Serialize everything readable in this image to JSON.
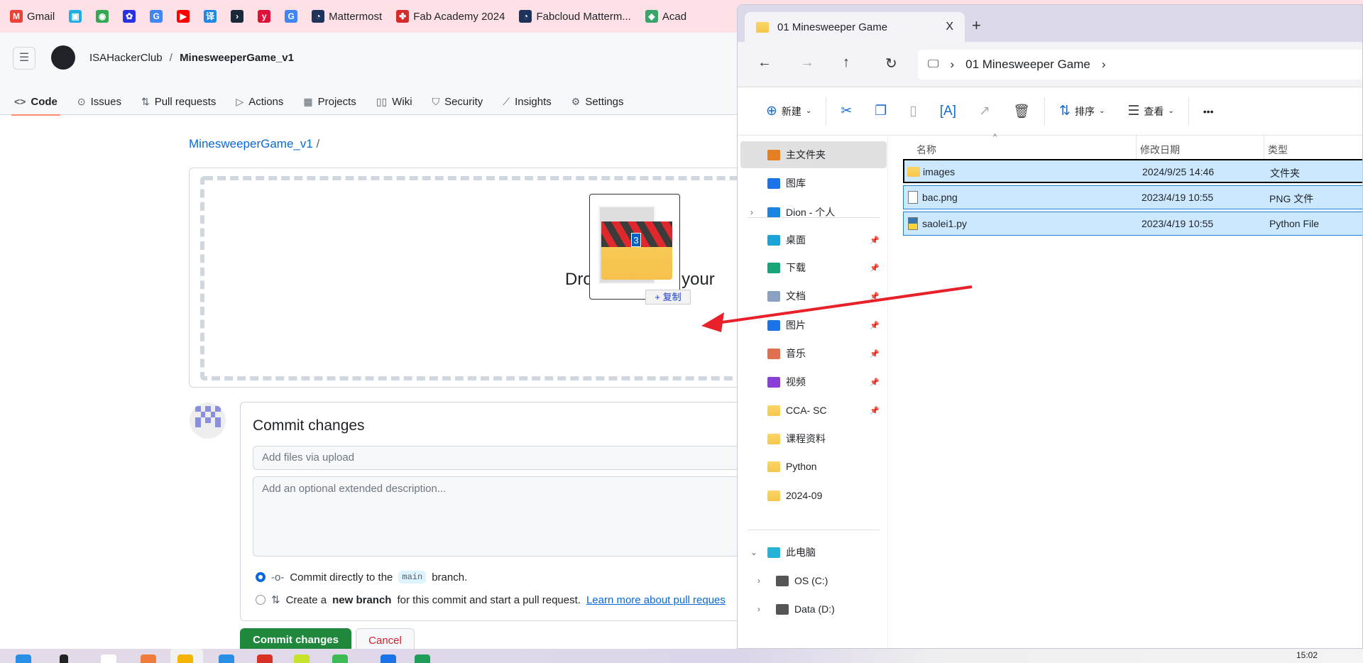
{
  "bookmarks": [
    {
      "label": "Gmail",
      "icon": "gmail-icon",
      "color": "#ea4335",
      "glyph": "M"
    },
    {
      "label": "",
      "icon": "bilibili-icon",
      "color": "#23ade5",
      "glyph": "▣"
    },
    {
      "label": "",
      "icon": "google-maps-icon",
      "color": "#34a853",
      "glyph": "◉"
    },
    {
      "label": "",
      "icon": "baidu-icon",
      "color": "#2932e1",
      "glyph": "✿"
    },
    {
      "label": "",
      "icon": "google-icon",
      "color": "#4285f4",
      "glyph": "G"
    },
    {
      "label": "",
      "icon": "youtube-icon",
      "color": "#ff0000",
      "glyph": "▶"
    },
    {
      "label": "",
      "icon": "translate-icon",
      "color": "#1e88e5",
      "glyph": "译"
    },
    {
      "label": "",
      "icon": "hex-app-icon",
      "color": "#1b2a3a",
      "glyph": "›"
    },
    {
      "label": "",
      "icon": "yuque-icon",
      "color": "#e0103a",
      "glyph": "y"
    },
    {
      "label": "",
      "icon": "google-translate-icon",
      "color": "#4285f4",
      "glyph": "G"
    },
    {
      "label": "Mattermost",
      "icon": "mattermost-icon",
      "color": "#1e325c",
      "glyph": "◔"
    },
    {
      "label": "Fab Academy 2024",
      "icon": "fablab-icon",
      "color": "#d62b2b",
      "glyph": "✤"
    },
    {
      "label": "Fabcloud Matterm...",
      "icon": "mattermost-icon",
      "color": "#1e325c",
      "glyph": "◔"
    },
    {
      "label": "Acad",
      "icon": "academy-icon",
      "color": "#3aa56b",
      "glyph": "◈"
    }
  ],
  "github": {
    "owner": "ISAHackerClub",
    "separator": "/",
    "repo": "MinesweeperGame_v1",
    "tabs": [
      {
        "label": "Code",
        "icon": "code-icon",
        "glyph": "<>",
        "active": true
      },
      {
        "label": "Issues",
        "icon": "issues-icon",
        "glyph": "⊙"
      },
      {
        "label": "Pull requests",
        "icon": "pull-request-icon",
        "glyph": "⇅"
      },
      {
        "label": "Actions",
        "icon": "actions-icon",
        "glyph": "▷"
      },
      {
        "label": "Projects",
        "icon": "projects-icon",
        "glyph": "▦"
      },
      {
        "label": "Wiki",
        "icon": "wiki-icon",
        "glyph": "▯▯"
      },
      {
        "label": "Security",
        "icon": "shield-icon",
        "glyph": "⛉"
      },
      {
        "label": "Insights",
        "icon": "graph-icon",
        "glyph": "⟋"
      },
      {
        "label": "Settings",
        "icon": "gear-icon",
        "glyph": "⚙"
      }
    ],
    "breadcrumb": {
      "repo": "MinesweeperGame_v1",
      "sep": "/"
    },
    "drop_text": "Drop to upload your",
    "drag": {
      "count": "3",
      "copy_label": "+ 复制"
    },
    "commit": {
      "title": "Commit changes",
      "summary_placeholder": "Add files via upload",
      "description_placeholder": "Add an optional extended description...",
      "option1_pre": "Commit directly to the",
      "option1_branch": "main",
      "option1_post": "branch.",
      "option2_pre": "Create a",
      "option2_bold": "new branch",
      "option2_post": "for this commit and start a pull request.",
      "option2_link": "Learn more about pull reques",
      "selected_option": 1,
      "submit_label": "Commit changes",
      "cancel_label": "Cancel"
    },
    "colors": {
      "primary": "#1f883d",
      "link": "#0969da",
      "danger": "#cf222e",
      "accent": "#fd8c73"
    }
  },
  "explorer": {
    "tab_title": "01 Minesweeper Game",
    "close": "X",
    "new_tab": "+",
    "address": [
      "01 Minesweeper Game"
    ],
    "toolbar": {
      "new": "新建",
      "sort": "排序",
      "view": "查看",
      "more": "•••"
    },
    "sidebar": [
      {
        "label": "主文件夹",
        "icon": "home-icon",
        "selected": true
      },
      {
        "label": "图库",
        "icon": "gallery-icon"
      },
      {
        "label": "Dion - 个人",
        "icon": "onedrive-icon",
        "expandable": true
      },
      {
        "label": "桌面",
        "icon": "desktop-icon",
        "pinned": true
      },
      {
        "label": "下载",
        "icon": "download-icon",
        "pinned": true
      },
      {
        "label": "文档",
        "icon": "documents-icon",
        "pinned": true
      },
      {
        "label": "图片",
        "icon": "pictures-icon",
        "pinned": true
      },
      {
        "label": "音乐",
        "icon": "music-icon",
        "pinned": true
      },
      {
        "label": "视频",
        "icon": "videos-icon",
        "pinned": true
      },
      {
        "label": "CCA- SC",
        "icon": "folder-icon",
        "pinned": true
      },
      {
        "label": "课程资料",
        "icon": "folder-icon"
      },
      {
        "label": "Python",
        "icon": "folder-icon"
      },
      {
        "label": "2024-09",
        "icon": "folder-icon"
      },
      {
        "label": "此电脑",
        "icon": "this-pc-icon",
        "expanded": true
      },
      {
        "label": "OS (C:)",
        "icon": "drive-c-icon",
        "expandable": true
      },
      {
        "label": "Data (D:)",
        "icon": "drive-d-icon",
        "expandable": true
      }
    ],
    "columns": {
      "name": "名称",
      "date": "修改日期",
      "type": "类型"
    },
    "files": [
      {
        "name": "images",
        "date": "2024/9/25 14:46",
        "type": "文件夹",
        "icon": "folder-icon"
      },
      {
        "name": "bac.png",
        "date": "2023/4/19 10:55",
        "type": "PNG 文件",
        "icon": "image-file-icon"
      },
      {
        "name": "saolei1.py",
        "date": "2023/4/19 10:55",
        "type": "Python File",
        "icon": "python-file-icon"
      }
    ]
  },
  "taskbar": {
    "clock": "15:02"
  }
}
